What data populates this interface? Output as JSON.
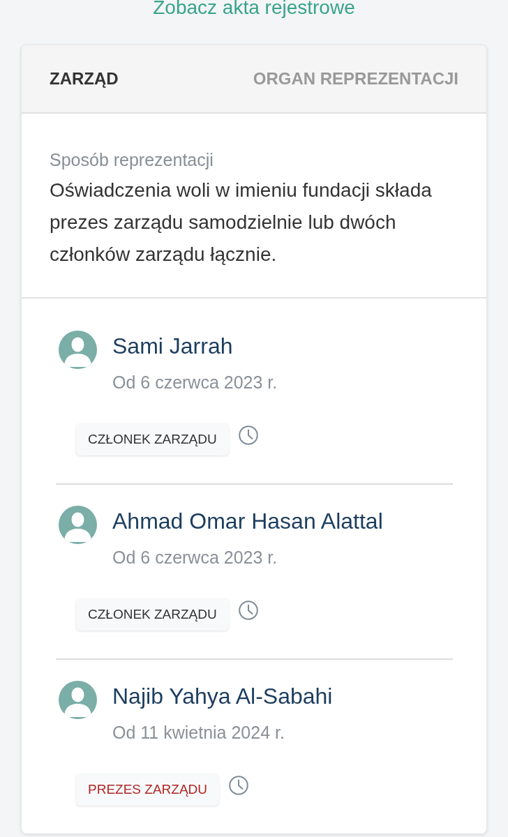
{
  "registry_link": "Zobacz akta rejestrowe",
  "tabs": [
    {
      "label": "ZARZĄD",
      "selected": true
    },
    {
      "label": "ORGAN REPREZENTACJI",
      "selected": false
    }
  ],
  "representation": {
    "label": "Sposób reprezentacji",
    "text": "Oświadczenia woli w imieniu fundacji składa prezes zarządu samodzielnie lub dwóch członków zarządu łącznie."
  },
  "members": [
    {
      "name": "Sami Jarrah",
      "since": "Od 6 czerwca 2023 r.",
      "role": {
        "label": "CZŁONEK ZARZĄDU",
        "kind": "member"
      }
    },
    {
      "name": "Ahmad Omar Hasan Alattal",
      "since": "Od 6 czerwca 2023 r.",
      "role": {
        "label": "CZŁONEK ZARZĄDU",
        "kind": "member"
      }
    },
    {
      "name": "Najib Yahya Al-Sabahi",
      "since": "Od 11 kwietnia 2024 r.",
      "role": {
        "label": "PREZES ZARZĄDU",
        "kind": "president"
      }
    }
  ]
}
